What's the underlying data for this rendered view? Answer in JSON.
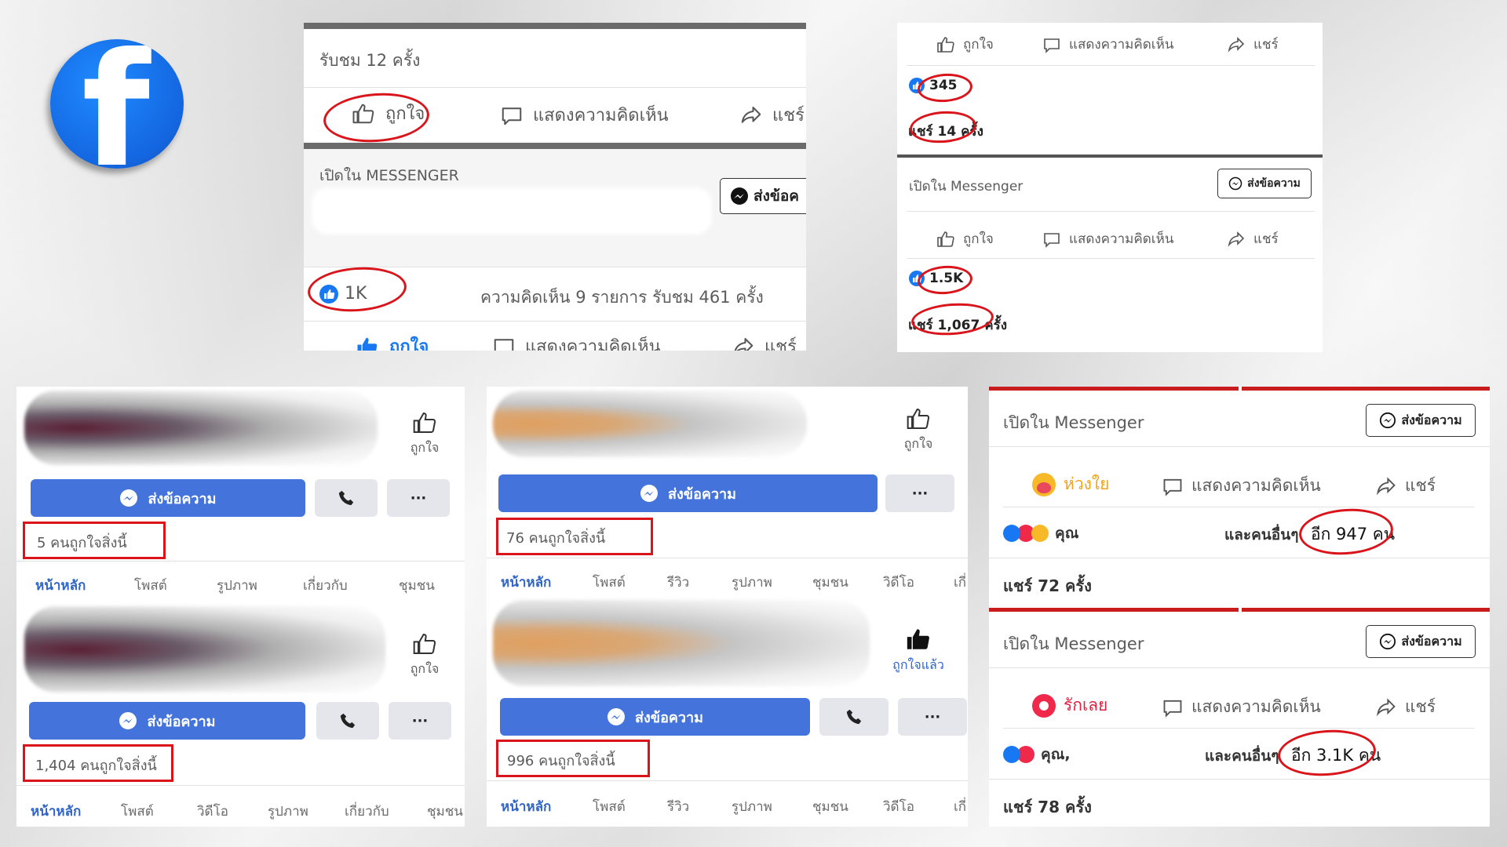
{
  "colors": {
    "facebook_blue": "#1877f2",
    "button_blue": "#4474db",
    "highlight_red": "#d9141b",
    "active_tab": "#2f64c8"
  },
  "logo": {
    "letter": "f"
  },
  "panel_top_center": {
    "views": "รับชม 12 ครั้ง",
    "like": "ถูกใจ",
    "comment": "แสดงความคิดเห็น",
    "share": "แชร์",
    "messenger_heading": "เปิดใน MESSENGER",
    "send_message": "ส่งข้อค",
    "like_count": "1K",
    "comments_views": "ความคิดเห็น 9 รายการ  รับชม 461 ครั้ง"
  },
  "panel_top_right": {
    "like": "ถูกใจ",
    "comment": "แสดงความคิดเห็น",
    "share": "แชร์",
    "like_count_1": "345",
    "shares_1": "แชร์ 14 ครั้ง",
    "messenger_heading": "เปิดใน Messenger",
    "send_message": "ส่งข้อความ",
    "like_count_2": "1.5K",
    "shares_2": "แชร์ 1,067 ครั้ง"
  },
  "panel_bottom_left": {
    "like": "ถูกใจ",
    "send_message": "ส่งข้อความ",
    "more": "···",
    "likes_1": "5 คนถูกใจสิ่งนี้",
    "likes_2": "1,404 คนถูกใจสิ่งนี้",
    "tabs_1": [
      "หน้าหลัก",
      "โพสต์",
      "รูปภาพ",
      "เกี่ยวกับ",
      "ชุมชน"
    ],
    "tabs_2": [
      "หน้าหลัก",
      "โพสต์",
      "วิดีโอ",
      "รูปภาพ",
      "เกี่ยวกับ",
      "ชุมชน"
    ]
  },
  "panel_bottom_center": {
    "like": "ถูกใจ",
    "liked": "ถูกใจแล้ว",
    "send_message": "ส่งข้อความ",
    "more": "···",
    "likes_1": "76 คนถูกใจสิ่งนี้",
    "likes_2": "996 คนถูกใจสิ่งนี้",
    "tabs": [
      "หน้าหลัก",
      "โพสต์",
      "รีวิว",
      "รูปภาพ",
      "ชุมชน",
      "วิดีโอ",
      "เกี่"
    ]
  },
  "panel_bottom_right": {
    "messenger_heading": "เปิดใน Messenger",
    "send_message": "ส่งข้อความ",
    "care": "ห่วงใย",
    "love": "รักเลย",
    "comment": "แสดงความคิดเห็น",
    "share": "แชร์",
    "you_1": "คุณ",
    "others_1": "และคนอื่นๆ",
    "count_1": "อีก 947 คน",
    "shares_1": "แชร์ 72 ครั้ง",
    "you_2": "คุณ,",
    "others_2": "และคนอื่นๆ",
    "count_2": "อีก 3.1K คน",
    "shares_2": "แชร์ 78 ครั้ง"
  }
}
